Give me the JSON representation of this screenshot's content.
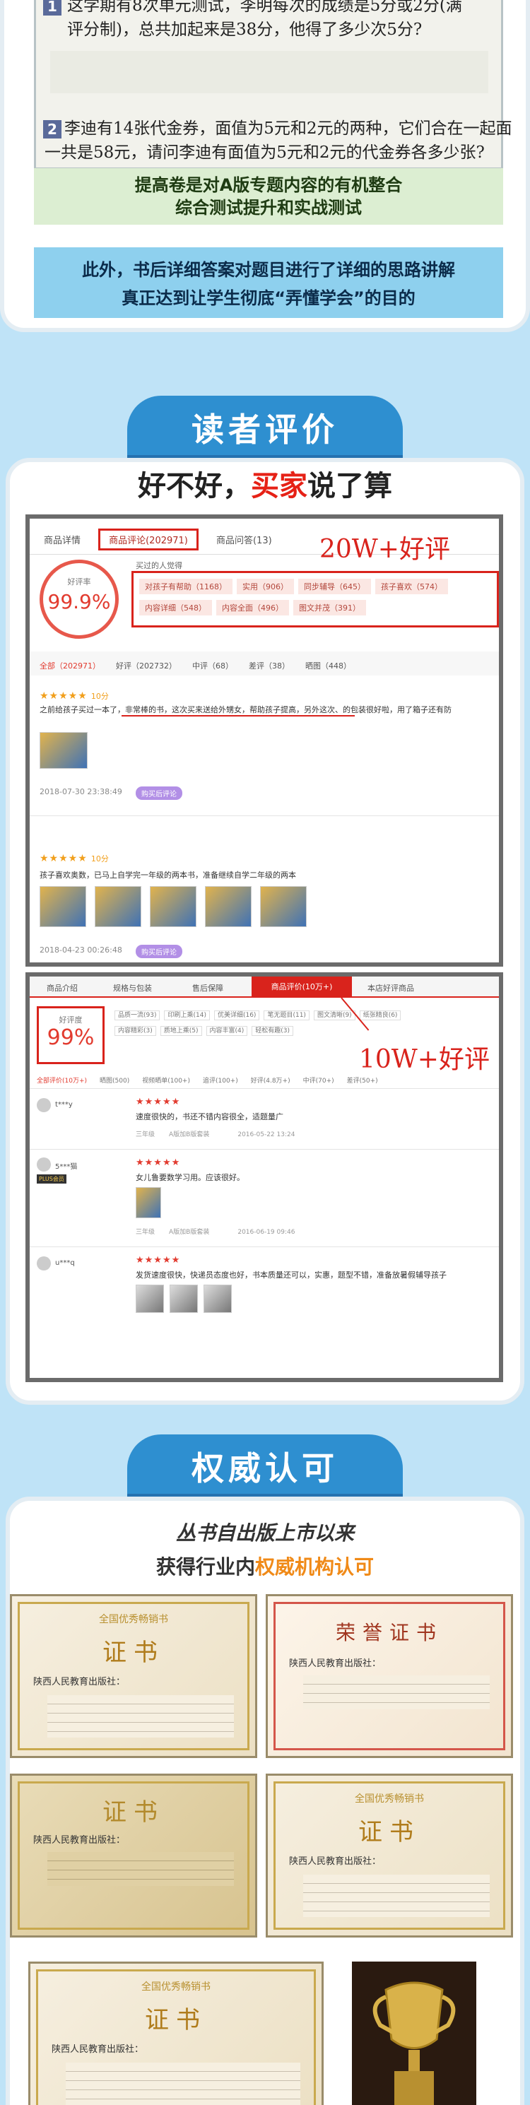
{
  "exam": {
    "q1_num": "1",
    "q1_line1": "这学期有8次单元测试，李明每次的成绩是5分或2分(满",
    "q1_line2": "评分制)，总共加起来是38分，他得了多少次5分?",
    "q2_num": "2",
    "q2_line1": "李迪有14张代金券，面值为5元和2元的两种，它们合在一起面",
    "q2_line2": "一共是58元，请问李迪有面值为5元和2元的代金券各多少张?",
    "green_line1": "提高卷是对A版专题内容的有机整合",
    "green_line2": "综合测试提升和实战测试",
    "blue_line1": "此外，书后详细答案对题目进行了详细的思路讲解",
    "blue_line2": "真正达到让学生彻底“弄懂学会”的目的"
  },
  "reviews_section": {
    "tab_title": "读者评价",
    "headline_a": "好不好，",
    "headline_b": "买家",
    "headline_c": "说了算",
    "shot1": {
      "tabs": [
        "商品详情",
        "商品评论(202971)",
        "商品问答(13)"
      ],
      "rate_label": "好评率",
      "rate_value": "99.9%",
      "buyers_label": "买过的人觉得",
      "tags": [
        "对孩子有帮助（1168）",
        "实用（906）",
        "同步辅导（645）",
        "孩子喜欢（574）",
        "内容详细（548）",
        "内容全面（496）",
        "图文并茂（391）"
      ],
      "filters": [
        "全部（202971）",
        "好评（202732）",
        "中评（68）",
        "差评（38）",
        "晒图（448）"
      ],
      "annotation": "20W+好评",
      "review1_stars": "★★★★★",
      "review1_score": "10分",
      "review1_text": "之前给孩子买过一本了，非常棒的书，这次买来送给外甥女，帮助孩子提高，另外这次、的包装很好啦，用了箱子还有防",
      "review1_time": "2018-07-30 23:38:49",
      "review1_badge": "购买后评论",
      "review2_stars": "★★★★★",
      "review2_score": "10分",
      "review2_text": "孩子喜欢奥数，已马上自学完一年级的两本书，准备继续自学二年级的两本",
      "review2_time": "2018-04-23 00:26:48",
      "review2_badge": "购买后评论"
    },
    "shot2": {
      "tabs": [
        "商品介绍",
        "规格与包装",
        "售后保障",
        "商品评价(10万+)",
        "本店好评商品"
      ],
      "rate_label": "好评度",
      "rate_value": "99%",
      "tags": [
        "品质一流(93)",
        "印刷上乘(14)",
        "优美详细(16)",
        "笔无题目(11)",
        "图文清晰(9)",
        "纸张精良(6)",
        "内容精彩(3)",
        "质地上乘(5)",
        "内容丰富(4)",
        "轻松有趣(3)"
      ],
      "annotation": "10W+好评",
      "filters": [
        "全部评价(10万+)",
        "晒图(500)",
        "视频晒单(100+)",
        "追评(100+)",
        "好评(4.8万+)",
        "中评(70+)",
        "差评(50+)"
      ],
      "reviews": [
        {
          "user": "t***y",
          "plus": "",
          "stars": "★★★★★",
          "text": "速度很快的，书还不错内容很全，适题量广",
          "meta": "三年级",
          "edition": "A版加B版套装",
          "time": "2016-05-22 13:24"
        },
        {
          "user": "5***猫",
          "plus": "PLUS会员",
          "stars": "★★★★★",
          "text": "女儿鲁要数学习用。应该很好。",
          "meta": "三年级",
          "edition": "A版加B版套装",
          "time": "2016-06-19 09:46"
        },
        {
          "user": "u***q",
          "plus": "",
          "stars": "★★★★★",
          "text": "发货速度很快，快递员态度也好，书本质量还可以，实惠，题型不错，准备放暑假辅导孩子",
          "meta": "",
          "edition": "",
          "time": ""
        }
      ]
    }
  },
  "authority_section": {
    "tab_title": "权威认可",
    "line1": "丛书自出版上市以来",
    "line2_a": "获得行业内",
    "line2_b": "权威机构认可",
    "certs": [
      {
        "head": "全国优秀畅销书",
        "title": "证书",
        "org": "陕西人民教育出版社："
      },
      {
        "head": "",
        "title": "荣誉证书",
        "org": "陕西人民教育出版社："
      },
      {
        "head": "",
        "title": "证书",
        "org": "陕西人民教育出版社："
      },
      {
        "head": "全国优秀畅销书",
        "title": "证书",
        "org": "陕西人民教育出版社："
      },
      {
        "head": "全国优秀畅销书",
        "title": "证书",
        "org": "陕西人民教育出版社："
      }
    ]
  }
}
